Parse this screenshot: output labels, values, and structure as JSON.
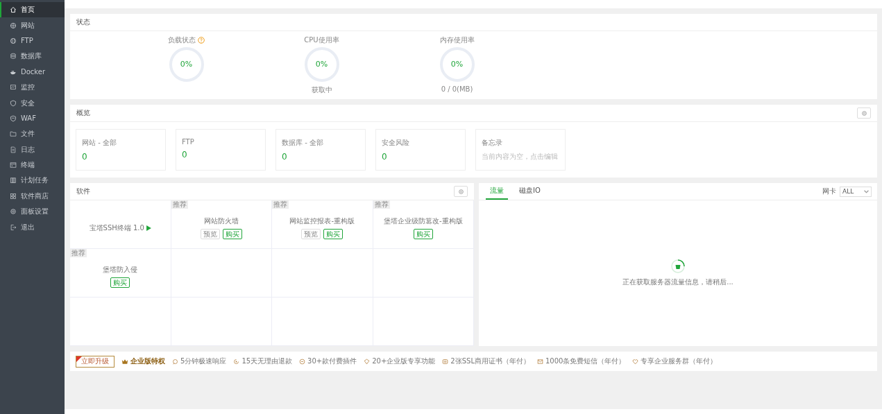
{
  "sidebar": {
    "items": [
      {
        "label": "首页",
        "selected": true
      },
      {
        "label": "网站",
        "selected": false
      },
      {
        "label": "FTP",
        "selected": false
      },
      {
        "label": "数据库",
        "selected": false
      },
      {
        "label": "Docker",
        "selected": false
      },
      {
        "label": "监控",
        "selected": false
      },
      {
        "label": "安全",
        "selected": false
      },
      {
        "label": "WAF",
        "selected": false
      },
      {
        "label": "文件",
        "selected": false
      },
      {
        "label": "日志",
        "selected": false
      },
      {
        "label": "终端",
        "selected": false
      },
      {
        "label": "计划任务",
        "selected": false
      },
      {
        "label": "软件商店",
        "selected": false
      },
      {
        "label": "面板设置",
        "selected": false
      },
      {
        "label": "退出",
        "selected": false
      }
    ]
  },
  "status": {
    "title": "状态",
    "gauges": [
      {
        "label": "负载状态",
        "help": true,
        "value": "0%",
        "level": 0
      },
      {
        "label": "CPU使用率",
        "value": "0%",
        "level": 0,
        "caption": "获取中"
      },
      {
        "label": "内存使用率",
        "value": "0%",
        "level": 0,
        "caption": "0 / 0(MB)"
      }
    ]
  },
  "overview": {
    "title": "概览",
    "cards": [
      {
        "label": "网站 - 全部",
        "value": "0"
      },
      {
        "label": "FTP",
        "value": "0"
      },
      {
        "label": "数据库 - 全部",
        "value": "0"
      },
      {
        "label": "安全风险",
        "value": "0"
      },
      {
        "label": "备忘录",
        "note": "当前内容为空，点击编辑"
      }
    ]
  },
  "software": {
    "title": "软件",
    "cells": [
      {
        "kind": "installed",
        "name": "宝塔SSH终端 1.0"
      },
      {
        "kind": "store",
        "tag": "推荐",
        "name": "网站防火墙",
        "preview": "预览",
        "buy": "购买"
      },
      {
        "kind": "store",
        "tag": "推荐",
        "name": "网站监控报表-重构版",
        "preview": "预览",
        "buy": "购买"
      },
      {
        "kind": "store",
        "tag": "推荐",
        "name": "堡塔企业级防篡改-重构版",
        "buy": "购买"
      },
      {
        "kind": "store",
        "tag": "推荐",
        "name": "堡塔防入侵",
        "buy": "购买"
      }
    ]
  },
  "traffic": {
    "tabs": [
      {
        "label": "流量",
        "selected": true
      },
      {
        "label": "磁盘IO",
        "selected": false
      }
    ],
    "nic_label": "网卡",
    "nic_value": "ALL",
    "loading": "正在获取服务器流量信息，请稍后..."
  },
  "upgrade_bar": {
    "button": "立即升级",
    "title": "企业版特权",
    "features": [
      "5分钟极速响应",
      "15天无理由退款",
      "30+款付费插件",
      "20+企业版专享功能",
      "2张SSL商用证书（年付）",
      "1000条免费短信（年付）",
      "专享企业服务群（年付）"
    ]
  }
}
